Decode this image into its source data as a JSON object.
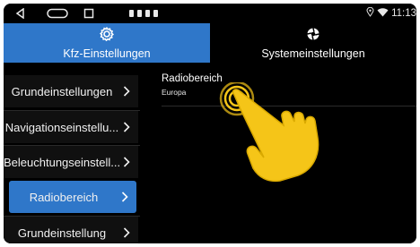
{
  "status_bar": {
    "clock": "11:13",
    "icons": [
      "back-icon",
      "home-icon",
      "recent-apps-icon",
      "location-icon",
      "wifi-icon"
    ]
  },
  "tabs": [
    {
      "label": "Kfz-Einstellungen",
      "icon": "gear-icon",
      "active": true
    },
    {
      "label": "Systemeinstellungen",
      "icon": "settings-cog-icon",
      "active": false
    }
  ],
  "sidebar": {
    "items": [
      {
        "label": "Grundeinstellungen",
        "active": false
      },
      {
        "label": "Navigationseinstellu...",
        "active": false
      },
      {
        "label": "Beleuchtungseinstell...",
        "active": false
      },
      {
        "label": "Radiobereich",
        "active": true
      },
      {
        "label": "Grundeinstellung",
        "active": false
      }
    ]
  },
  "main": {
    "setting_title": "Radiobereich",
    "setting_value": "Europa"
  },
  "colors": {
    "accent": "#2f77c9",
    "background": "#000000",
    "hand": "#f5c518"
  }
}
